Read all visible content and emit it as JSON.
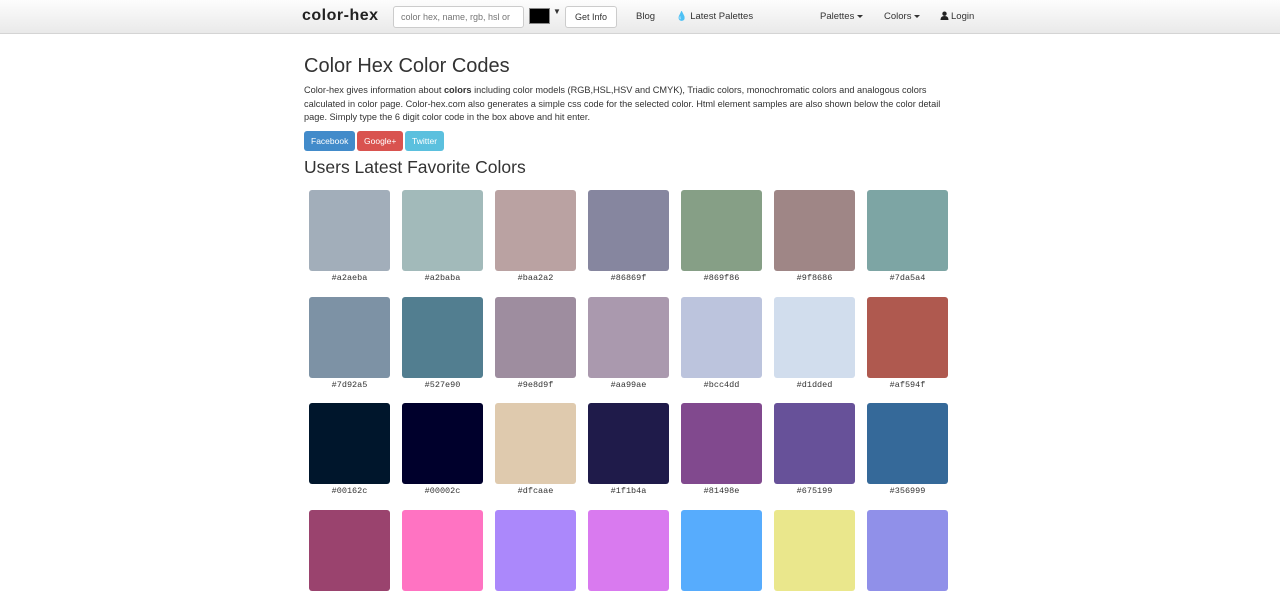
{
  "navbar": {
    "brand": "color-hex",
    "search_placeholder": "color hex, name, rgb, hsl or",
    "picker_color": "#000000",
    "get_info_label": "Get Info",
    "blog_label": "Blog",
    "latest_palettes_label": "Latest Palettes",
    "palettes_label": "Palettes",
    "colors_label": "Colors",
    "login_label": "Login"
  },
  "main": {
    "title": "Color Hex Color Codes",
    "intro_before": "Color-hex gives information about ",
    "intro_bold": "colors",
    "intro_after": " including color models (RGB,HSL,HSV and CMYK), Triadic colors, monochromatic colors and analogous colors calculated in color page. Color-hex.com also generates a simple css code for the selected color. Html element samples are also shown below the color detail page. Simply type the 6 digit color code in the box above and hit enter.",
    "share": {
      "facebook": "Facebook",
      "google": "Google+",
      "twitter": "Twitter"
    },
    "favorites_title": "Users Latest Favorite Colors"
  },
  "colors": [
    {
      "hex": "#a2aeba"
    },
    {
      "hex": "#a2baba"
    },
    {
      "hex": "#baa2a2"
    },
    {
      "hex": "#86869f"
    },
    {
      "hex": "#869f86"
    },
    {
      "hex": "#9f8686"
    },
    {
      "hex": "#7da5a4"
    },
    {
      "hex": "#7d92a5"
    },
    {
      "hex": "#527e90"
    },
    {
      "hex": "#9e8d9f"
    },
    {
      "hex": "#aa99ae"
    },
    {
      "hex": "#bcc4dd"
    },
    {
      "hex": "#d1dded"
    },
    {
      "hex": "#af594f"
    },
    {
      "hex": "#00162c"
    },
    {
      "hex": "#00002c"
    },
    {
      "hex": "#dfcaae"
    },
    {
      "hex": "#1f1b4a"
    },
    {
      "hex": "#81498e"
    },
    {
      "hex": "#675199"
    },
    {
      "hex": "#356999"
    },
    {
      "hex": "#9a436e",
      "label": ""
    },
    {
      "hex": "#ff73c2",
      "label": ""
    },
    {
      "hex": "#ab88fb",
      "label": ""
    },
    {
      "hex": "#d97aef",
      "label": ""
    },
    {
      "hex": "#57acfd",
      "label": ""
    },
    {
      "hex": "#eae78c",
      "label": ""
    },
    {
      "hex": "#9090e9",
      "label": ""
    }
  ]
}
